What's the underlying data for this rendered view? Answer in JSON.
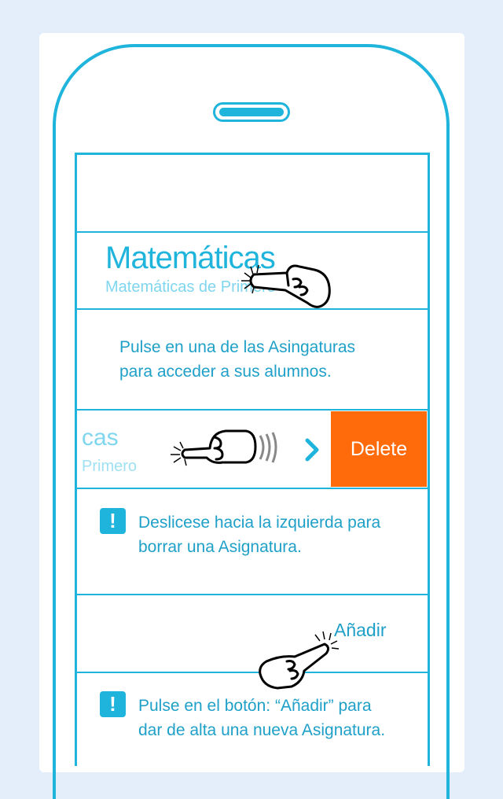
{
  "subject_cell": {
    "title": "Matemáticas",
    "subtitle": "Matemáticas de Primero"
  },
  "hint_tap": {
    "line1": "Pulse en una de las Asingaturas",
    "line2": "para acceder a sus alumnos."
  },
  "swiped_cell": {
    "title": "cas",
    "subtitle": "Primero",
    "delete_label": "Delete"
  },
  "hint_swipe": {
    "line1": "Deslicese hacia la izquierda para",
    "line2": "borrar una Asignatura."
  },
  "add_button": {
    "label": "Añadir"
  },
  "hint_add": {
    "line1": "Pulse en el botón: “Añadir” para",
    "line2": "dar de alta una nueva Asignatura."
  },
  "colors": {
    "accent": "#1fb4dc",
    "delete": "#ff6a0a",
    "background": "#e3eefa"
  }
}
